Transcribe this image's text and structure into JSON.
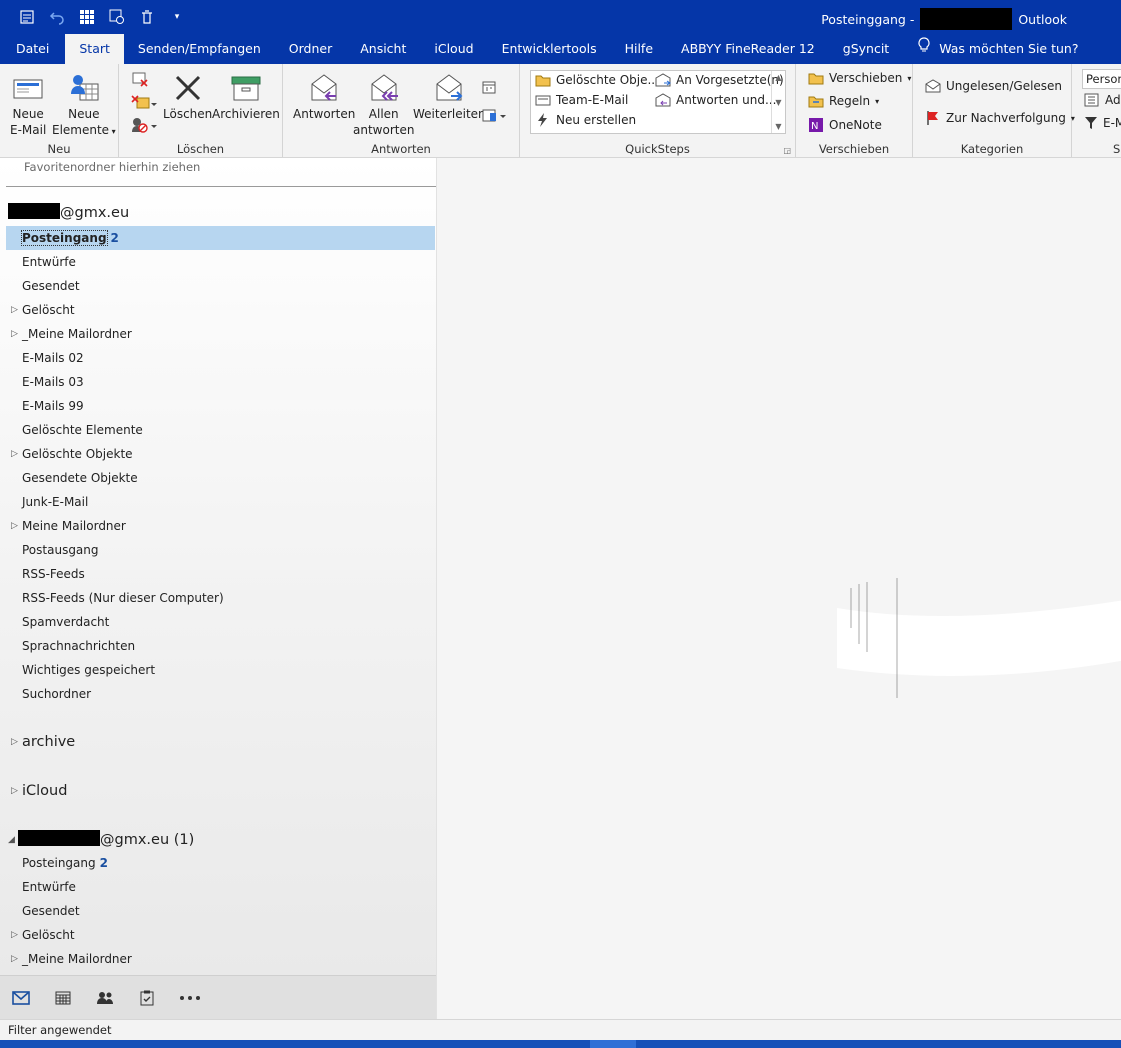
{
  "titlebar": {
    "folder": "Posteinggang -",
    "app": "Outlook"
  },
  "tabs": [
    {
      "label": "Datei"
    },
    {
      "label": "Start"
    },
    {
      "label": "Senden/Empfangen"
    },
    {
      "label": "Ordner"
    },
    {
      "label": "Ansicht"
    },
    {
      "label": "iCloud"
    },
    {
      "label": "Entwicklertools"
    },
    {
      "label": "Hilfe"
    },
    {
      "label": "ABBYY FineReader 12"
    },
    {
      "label": "gSyncit"
    }
  ],
  "tellme": "Was möchten Sie tun?",
  "ribbon": {
    "neu": {
      "group": "Neu",
      "new_email_1": "Neue",
      "new_email_2": "E-Mail",
      "new_items_1": "Neue",
      "new_items_2": "Elemente"
    },
    "loeschen": {
      "group": "Löschen",
      "delete": "Löschen",
      "archive": "Archivieren"
    },
    "antworten": {
      "group": "Antworten",
      "reply": "Antworten",
      "reply_all_1": "Allen",
      "reply_all_2": "antworten",
      "forward": "Weiterleiten"
    },
    "quicksteps": {
      "group": "QuickSteps",
      "items": [
        "Gelöschte Obje...",
        "An Vorgesetzte(n)",
        "Team-E-Mail",
        "Antworten und...",
        "Neu erstellen"
      ]
    },
    "verschieben": {
      "group": "Verschieben",
      "move": "Verschieben",
      "rules": "Regeln",
      "onenote": "OneNote"
    },
    "kategorien": {
      "group": "Kategorien",
      "unread": "Ungelesen/Gelesen",
      "followup": "Zur Nachverfolgung"
    },
    "suchen": {
      "search_value": "Person",
      "address": "Adr",
      "filter": "E-M",
      "group": "S"
    }
  },
  "folders": {
    "favorites_hint": "Favoritenordner hierhin ziehen",
    "account1": "@gmx.eu",
    "account1_items": [
      {
        "name": "Posteingang",
        "count": "2"
      },
      {
        "name": "Entwürfe"
      },
      {
        "name": "Gesendet"
      },
      {
        "name": "Gelöscht"
      },
      {
        "name": "_Meine Mailordner"
      },
      {
        "name": "E-Mails 02"
      },
      {
        "name": "E-Mails 03"
      },
      {
        "name": "E-Mails 99"
      },
      {
        "name": "Gelöschte Elemente"
      },
      {
        "name": "Gelöschte Objekte"
      },
      {
        "name": "Gesendete Objekte"
      },
      {
        "name": "Junk-E-Mail"
      },
      {
        "name": "Meine Mailordner"
      },
      {
        "name": "Postausgang"
      },
      {
        "name": "RSS-Feeds"
      },
      {
        "name": "RSS-Feeds (Nur dieser Computer)"
      },
      {
        "name": "Spamverdacht"
      },
      {
        "name": "Sprachnachrichten"
      },
      {
        "name": "Wichtiges gespeichert"
      },
      {
        "name": "Suchordner"
      }
    ],
    "archive": "archive",
    "icloud": "iCloud",
    "account2": "@gmx.eu (1)",
    "account2_items": [
      {
        "name": "Posteingang",
        "count": "2"
      },
      {
        "name": "Entwürfe"
      },
      {
        "name": "Gesendet"
      },
      {
        "name": "Gelöscht"
      },
      {
        "name": "_Meine Mailordner"
      }
    ]
  },
  "status": "Filter angewendet",
  "colors": {
    "titlebar": "#0536a8",
    "selected_folder": "#b7d6f0",
    "unread_count": "#1a4fa0"
  }
}
